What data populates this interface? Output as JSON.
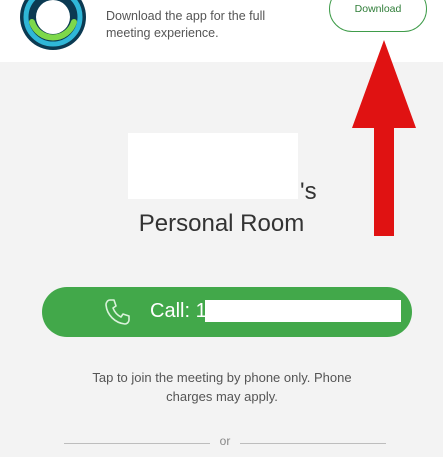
{
  "banner": {
    "logo_icon": "webex-logo-icon",
    "line1": "Download the app for the full",
    "line2": "meeting experience.",
    "download_label": "Download"
  },
  "room": {
    "owner_suffix": "'s",
    "title": "Personal Room"
  },
  "call": {
    "icon": "phone-icon",
    "label": "Call: 1"
  },
  "info": {
    "line1": "Tap to join the meeting by phone only. Phone",
    "line2": "charges may apply."
  },
  "divider": {
    "text": "or"
  },
  "colors": {
    "accent_green": "#42a84a",
    "annotation_red": "#e01212",
    "background": "#f3f3f3"
  }
}
